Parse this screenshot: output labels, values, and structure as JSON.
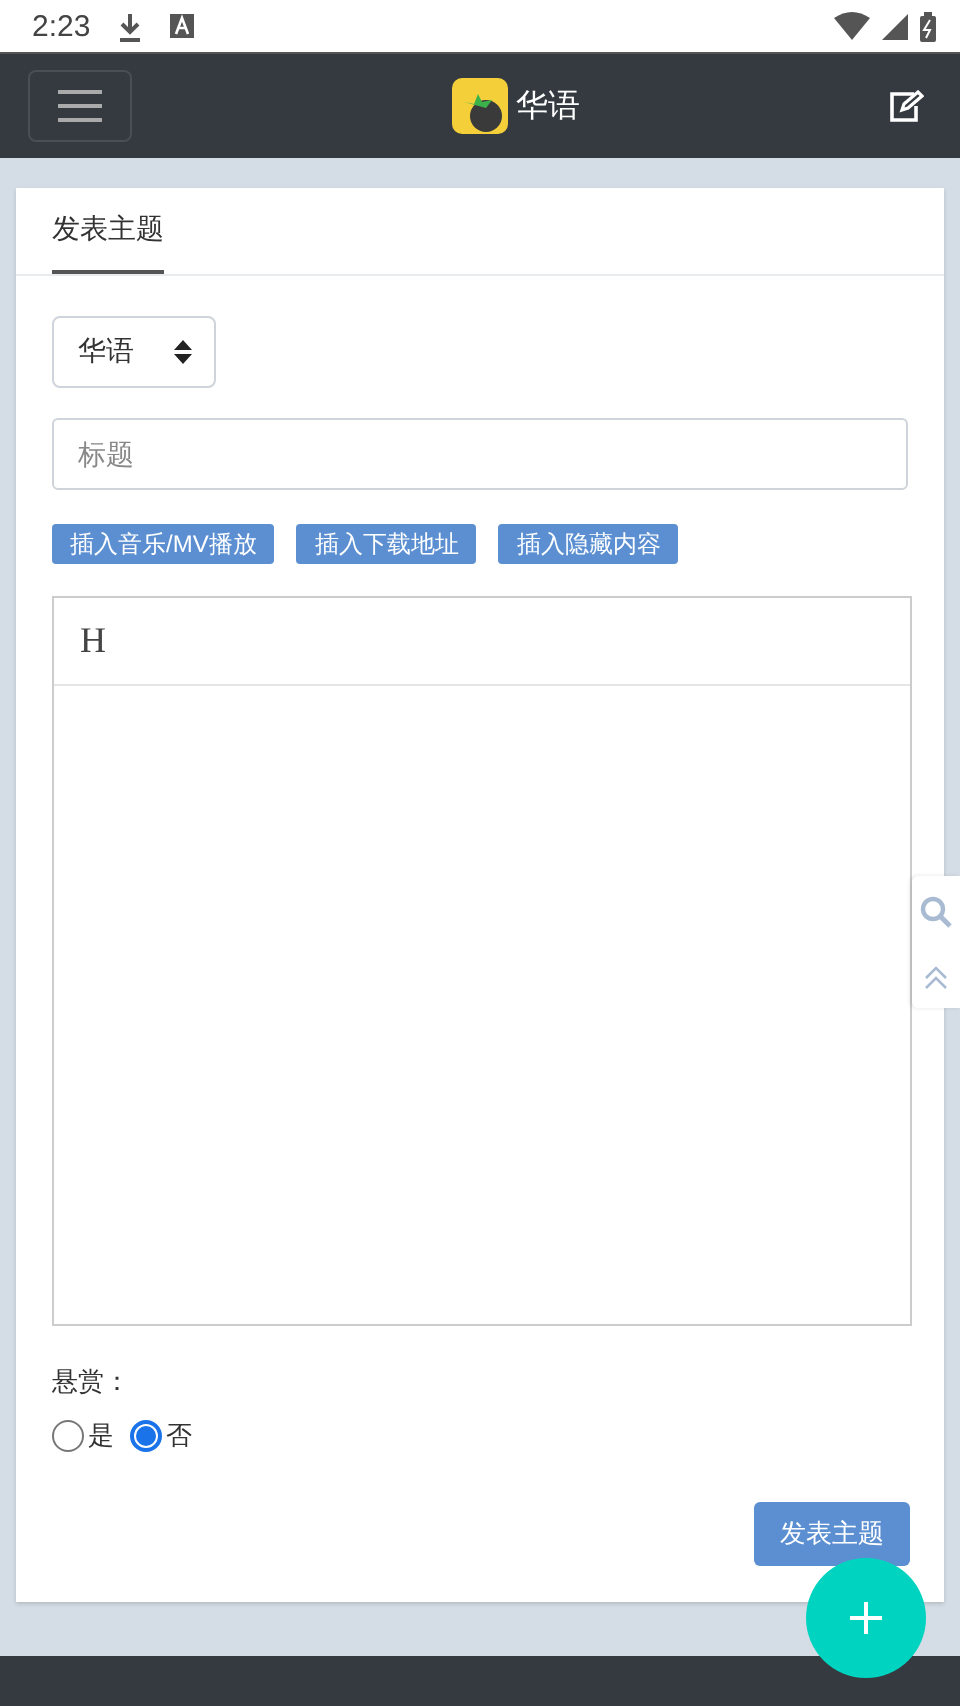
{
  "status_bar": {
    "time": "2:23"
  },
  "navbar": {
    "title": "华语"
  },
  "tabs": [
    {
      "label": "发表主题",
      "selected": true
    }
  ],
  "form": {
    "category": {
      "value": "华语"
    },
    "title_field": {
      "placeholder": "标题"
    },
    "insert_buttons": [
      "插入音乐/MV播放",
      "插入下载地址",
      "插入隐藏内容"
    ],
    "editor": {
      "toolbar": [
        "H"
      ]
    },
    "reward": {
      "label": "悬赏：",
      "options": [
        {
          "label": "是",
          "selected": false
        },
        {
          "label": "否",
          "selected": true
        }
      ]
    },
    "submit": "发表主题"
  }
}
